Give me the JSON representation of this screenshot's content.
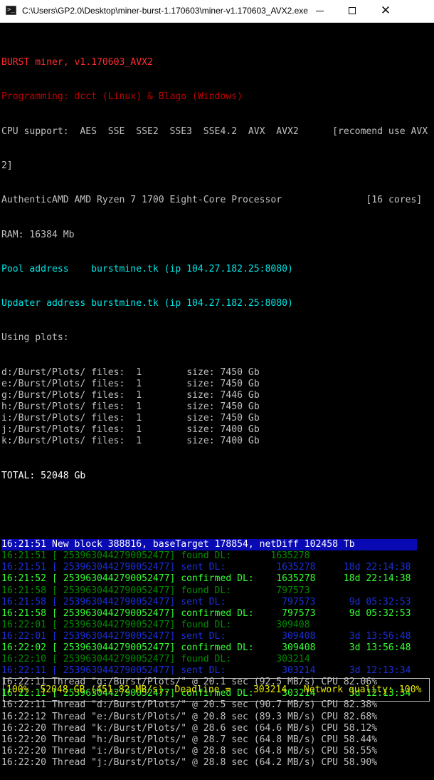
{
  "window": {
    "title": "C:\\Users\\GP2.0\\Desktop\\miner-burst-1.170603\\miner-v1.170603_AVX2.exe",
    "icon": "console-window-icon",
    "icon_glyph": ">_",
    "minimize_glyph": "minimize-icon",
    "maximize_glyph": "maximize-icon",
    "close_glyph": "✕"
  },
  "header": {
    "title": "BURST miner, v1.170603_AVX2",
    "credits": "Programming: dcct (Linux) & Blago (Windows)",
    "cpu_support": "CPU support:  AES  SSE  SSE2  SSE3  SSE4.2  AVX  AVX2      [recomend use AVX",
    "cpu_support_wrap": "2]",
    "processor": "AuthenticAMD AMD Ryzen 7 1700 Eight-Core Processor",
    "cores": "[16 cores]",
    "ram": "RAM: 16384 Mb",
    "pool": "Pool address    burstmine.tk (ip 104.27.182.25:8080)",
    "updater": "Updater address burstmine.tk (ip 104.27.182.25:8080)",
    "using_plots": "Using plots:",
    "total": "TOTAL: 52048 Gb"
  },
  "plots": [
    {
      "path": "d:/Burst/Plots/",
      "files": "1",
      "size": "7450 Gb"
    },
    {
      "path": "e:/Burst/Plots/",
      "files": "1",
      "size": "7450 Gb"
    },
    {
      "path": "g:/Burst/Plots/",
      "files": "1",
      "size": "7446 Gb"
    },
    {
      "path": "h:/Burst/Plots/",
      "files": "1",
      "size": "7450 Gb"
    },
    {
      "path": "i:/Burst/Plots/",
      "files": "1",
      "size": "7450 Gb"
    },
    {
      "path": "j:/Burst/Plots/",
      "files": "1",
      "size": "7400 Gb"
    },
    {
      "path": "k:/Burst/Plots/",
      "files": "1",
      "size": "7400 Gb"
    }
  ],
  "plot_row_format": {
    "files_label": "files:",
    "size_label": "size:"
  },
  "log": [
    {
      "text": "16:21:51 New block 388816, baseTarget 178854, netDiff 102458 Tb",
      "style": "block"
    },
    {
      "text": "16:21:51 [ 2539630442790052477] found DL:       1635278",
      "style": "found"
    },
    {
      "text": "16:21:51 [ 2539630442790052477] sent DL:         1635278     18d 22:14:38",
      "style": "sent"
    },
    {
      "text": "16:21:52 [ 2539630442790052477] confirmed DL:    1635278     18d 22:14:38",
      "style": "confirmed"
    },
    {
      "text": "16:21:58 [ 2539630442790052477] found DL:        797573",
      "style": "found"
    },
    {
      "text": "16:21:58 [ 2539630442790052477] sent DL:          797573      9d 05:32:53",
      "style": "sent"
    },
    {
      "text": "16:21:58 [ 2539630442790052477] confirmed DL:     797573      9d 05:32:53",
      "style": "confirmed"
    },
    {
      "text": "16:22:01 [ 2539630442790052477] found DL:        309408",
      "style": "found"
    },
    {
      "text": "16:22:01 [ 2539630442790052477] sent DL:          309408      3d 13:56:48",
      "style": "sent"
    },
    {
      "text": "16:22:02 [ 2539630442790052477] confirmed DL:     309408      3d 13:56:48",
      "style": "confirmed"
    },
    {
      "text": "16:22:10 [ 2539630442790052477] found DL:        303214",
      "style": "found"
    },
    {
      "text": "16:22:11 [ 2539630442790052477] sent DL:          303214      3d 12:13:34",
      "style": "sent"
    },
    {
      "text": "16:22:11 Thread \"g:/Burst/Plots/\" @ 20.1 sec (92.5 MB/s) CPU 82.06%",
      "style": "thread"
    },
    {
      "text": "16:22:11 [ 2539630442790052477] confirmed DL:     303214      3d 12:13:34",
      "style": "confirmed"
    },
    {
      "text": "16:22:11 Thread \"d:/Burst/Plots/\" @ 20.5 sec (90.7 MB/s) CPU 82.38%",
      "style": "thread"
    },
    {
      "text": "16:22:12 Thread \"e:/Burst/Plots/\" @ 20.8 sec (89.3 MB/s) CPU 82.68%",
      "style": "thread"
    },
    {
      "text": "16:22:20 Thread \"k:/Burst/Plots/\" @ 28.6 sec (64.6 MB/s) CPU 58.12%",
      "style": "thread"
    },
    {
      "text": "16:22:20 Thread \"h:/Burst/Plots/\" @ 28.7 sec (64.8 MB/s) CPU 58.44%",
      "style": "thread"
    },
    {
      "text": "16:22:20 Thread \"i:/Burst/Plots/\" @ 28.8 sec (64.8 MB/s) CPU 58.55%",
      "style": "thread"
    },
    {
      "text": "16:22:20 Thread \"j:/Burst/Plots/\" @ 28.8 sec (64.2 MB/s) CPU 58.90%",
      "style": "thread"
    }
  ],
  "status": {
    "progress": "100%",
    "capacity": "52048 GB (451.82 MB/s).",
    "deadline_label": "Deadline =",
    "deadline_value": "303214",
    "network_label": "Network quality:",
    "network_value": "100%"
  },
  "colors": {
    "title": "#ff2d2d",
    "credits": "#c00000",
    "address": "#00e5e5",
    "found": "#008c00",
    "sent": "#1b2fd8",
    "confirmed": "#33ff33",
    "block_bg": "#0a0ab4",
    "status": "#e6e600"
  }
}
